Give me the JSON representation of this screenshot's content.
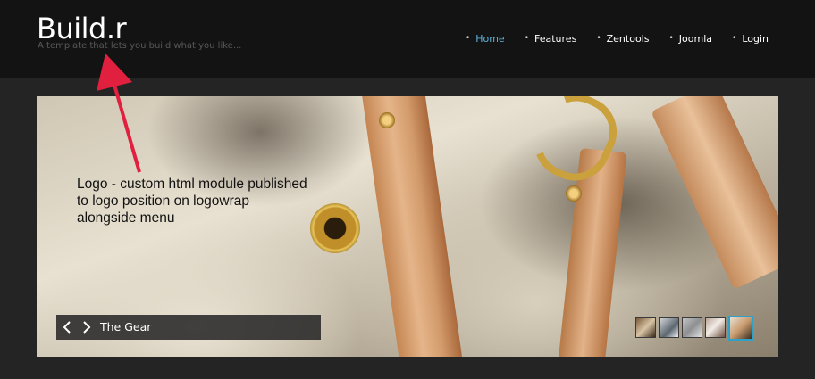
{
  "header": {
    "logo_title": "Build.r",
    "tagline": "A template that lets you build what you like..."
  },
  "nav": {
    "items": [
      {
        "label": "Home",
        "active": true
      },
      {
        "label": "Features",
        "active": false
      },
      {
        "label": "Zentools",
        "active": false
      },
      {
        "label": "Joomla",
        "active": false
      },
      {
        "label": "Login",
        "active": false
      }
    ]
  },
  "annotation": {
    "text": "Logo - custom html module published to logo position on logowrap alongside menu"
  },
  "slider": {
    "caption": "The Gear",
    "prev_icon": "chevron-left-icon",
    "next_icon": "chevron-right-icon",
    "thumbnails": 5,
    "active_thumbnail": 5
  },
  "colors": {
    "header_bg": "#131313",
    "page_bg": "#242424",
    "nav_active": "#5cb3d9",
    "annotation_arrow": "#e0203e",
    "thumb_active_border": "#2fa0c8"
  }
}
